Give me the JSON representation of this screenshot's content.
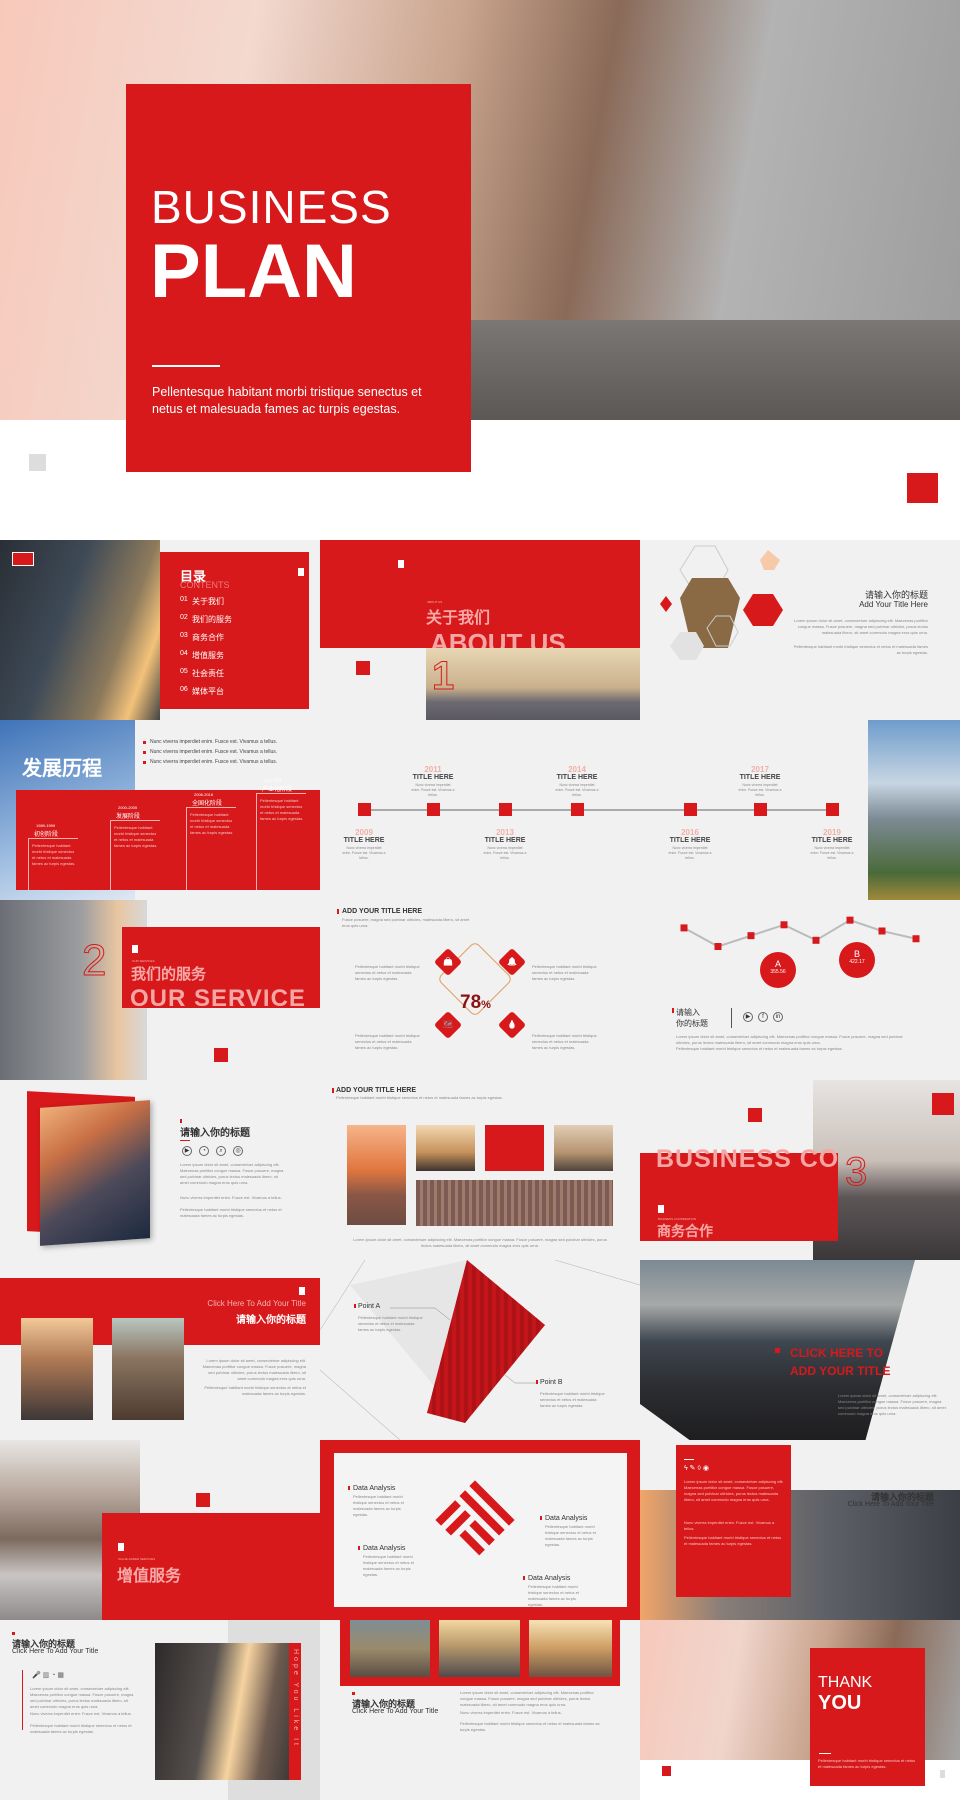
{
  "colors": {
    "accent": "#d7191b",
    "background": "#f2f2f2"
  },
  "cover": {
    "title_line1": "BUSINESS",
    "title_line2": "PLAN",
    "subtitle": "Pellentesque habitant morbi tristique senectus et netus et malesuada fames ac turpis egestas."
  },
  "lorem": {
    "short": "Pellentesque habitant morbi tristique senectus et netus et malesuada fames ac turpis egestas.",
    "long": "Lorem ipsum dolor sit amet, consectetuer adipiscing elit. Maecenas porttitor congue massa. Fusce posuere, magna sed pulvinar ultricies, purus lectus malesuada libero, sit amet commodo magna eros quis urna.",
    "nunc": "Nunc viverra imperdiet enim. Fusce est. Vivamus a tellus.",
    "fusce": "Fusce posuere, magna sed pulvinar ultricies, malesuada libero, sit amet eros quis urna."
  },
  "contents": {
    "title": "目录",
    "title_en": "CONTENTS",
    "items": [
      {
        "num": "01",
        "label": "关于我们"
      },
      {
        "num": "02",
        "label": "我们的服务"
      },
      {
        "num": "03",
        "label": "商务合作"
      },
      {
        "num": "04",
        "label": "增值服务"
      },
      {
        "num": "05",
        "label": "社会责任"
      },
      {
        "num": "06",
        "label": "媒体平台"
      }
    ]
  },
  "about": {
    "small": "ABOUT US",
    "cn": "关于我们",
    "en": "ABOUT US",
    "number": "1"
  },
  "hex_slide": {
    "title_cn": "请输入你的标题",
    "title_en": "Add Your Title Here"
  },
  "history": {
    "title": "发展历程",
    "bullets": [
      "Nunc viverra imperdiet enim. Fusce est. Vivamus a tellus.",
      "Nunc viverra imperdiet enim. Fusce est. Vivamus a tellus.",
      "Nunc viverra imperdiet enim. Fusce est. Vivamus a tellus."
    ],
    "stages": [
      {
        "years": "1989-1999",
        "name": "初创阶段"
      },
      {
        "years": "2000-2005",
        "name": "发展阶段"
      },
      {
        "years": "2006-2016",
        "name": "全国化阶段"
      },
      {
        "years": "2017-至今",
        "name": "产业化阶段"
      }
    ]
  },
  "timeline": {
    "events": [
      {
        "year": "2009",
        "title": "TITLE HERE",
        "pos": "bottom"
      },
      {
        "year": "2011",
        "title": "TITLE HERE",
        "pos": "top"
      },
      {
        "year": "2013",
        "title": "TITLE HERE",
        "pos": "bottom"
      },
      {
        "year": "2014",
        "title": "TITLE HERE",
        "pos": "top"
      },
      {
        "year": "2016",
        "title": "TITLE HERE",
        "pos": "bottom"
      },
      {
        "year": "2017",
        "title": "TITLE HERE",
        "pos": "top"
      },
      {
        "year": "2019",
        "title": "TITLE HERE",
        "pos": "bottom"
      }
    ],
    "desc": "Nunc viverra imperdiet enim. Fusce est. Vivamus a tellus."
  },
  "services": {
    "small": "OUR SERVICES",
    "cn": "我们的服务",
    "en": "OUR SERVICE",
    "number": "2"
  },
  "percent_slide": {
    "title": "ADD YOUR TITLE HERE",
    "percent": "78",
    "percent_sign": "%",
    "icons": [
      "shopping-bag-icon",
      "bell-icon",
      "map-icon",
      "drop-icon"
    ]
  },
  "line_slide": {
    "points": [
      42,
      30,
      37,
      44,
      34,
      47,
      40,
      35
    ],
    "callouts": [
      {
        "label": "A",
        "value": "355.56"
      },
      {
        "label": "B",
        "value": "422.17"
      }
    ],
    "title_line1": "请输入",
    "title_line2": "你的标题",
    "social": [
      "youtube-icon",
      "facebook-icon",
      "linkedin-icon"
    ]
  },
  "frame_slide": {
    "title": "请输入你的标题"
  },
  "gallery_slide": {
    "title": "ADD YOUR TITLE HERE"
  },
  "business": {
    "en": "BUSINESS COOPERATION",
    "en_visible": "BUSINESS CO",
    "small": "BUSINESS COOPERATION",
    "cn": "商务合作",
    "number": "3"
  },
  "band_slide": {
    "title_en": "Click Here To Add Your Title",
    "title_cn": "请输入你的标题"
  },
  "points_slide": {
    "a": "Point A",
    "b": "Point B"
  },
  "pagoda_slide": {
    "line1": "CLICK HERE TO",
    "line2": "ADD YOUR TITLE"
  },
  "value_added": {
    "small": "VALUE-ADDED SERVICES",
    "cn": "增值服务"
  },
  "analysis": {
    "labels": [
      "Data Analysis",
      "Data Analysis",
      "Data Analysis",
      "Data Analysis"
    ]
  },
  "redbox_slide": {
    "title_cn": "请输入你的标题",
    "title_en": "Click Here To Add Your Title"
  },
  "hope_slide": {
    "title_cn": "请输入你的标题",
    "title_en": "Click Here To Add Your Title",
    "vertical": "Hope You Like It"
  },
  "three_photo_slide": {
    "title_cn": "请输入你的标题",
    "title_en": "Click Here To Add Your Title"
  },
  "thanks": {
    "line1": "THANK",
    "line2": "YOU"
  }
}
